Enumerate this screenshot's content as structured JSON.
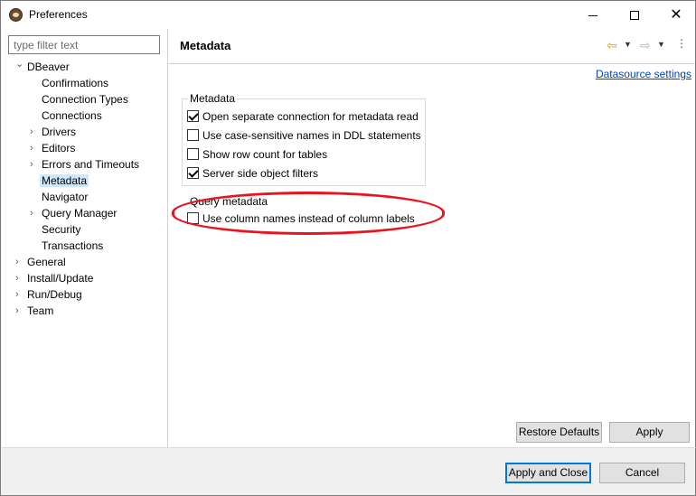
{
  "window": {
    "title": "Preferences",
    "min_glyph": "",
    "close_glyph": "✕"
  },
  "filter": {
    "placeholder": "type filter text",
    "value": ""
  },
  "tree": {
    "dbeaver": "DBeaver",
    "confirmations": "Confirmations",
    "connection_types": "Connection Types",
    "connections": "Connections",
    "drivers": "Drivers",
    "editors": "Editors",
    "errors_timeouts": "Errors and Timeouts",
    "metadata": "Metadata",
    "navigator": "Navigator",
    "query_manager": "Query Manager",
    "security": "Security",
    "transactions": "Transactions",
    "general": "General",
    "install_update": "Install/Update",
    "run_debug": "Run/Debug",
    "team": "Team",
    "expanded_glyph": "⌄",
    "collapsed_glyph": "›"
  },
  "page": {
    "title": "Metadata",
    "back_glyph": "⇦",
    "fwd_glyph": "⇨",
    "dropdown_glyph": "▼",
    "menu_glyph": "⋮",
    "datasource_link": "Datasource settings"
  },
  "metadata_group": {
    "title": "Metadata",
    "options": [
      {
        "label": "Open separate connection for metadata read",
        "checked": true
      },
      {
        "label": "Use case-sensitive names in DDL statements",
        "checked": false
      },
      {
        "label": "Show row count for tables",
        "checked": false
      },
      {
        "label": "Server side object filters",
        "checked": true
      }
    ]
  },
  "query_group": {
    "title": "Query metadata",
    "options": [
      {
        "label": "Use column names instead of column labels",
        "checked": false
      }
    ]
  },
  "buttons": {
    "restore_defaults": "Restore Defaults",
    "apply": "Apply",
    "apply_and_close": "Apply and Close",
    "cancel": "Cancel"
  },
  "colors": {
    "selection": "#cce8ff",
    "link": "#0645ad",
    "annotation": "#e8141e",
    "default_button_border": "#0078d7"
  }
}
